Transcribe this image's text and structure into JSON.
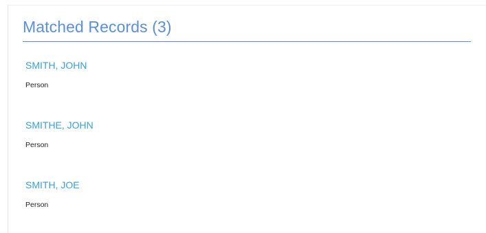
{
  "matched_records": {
    "title": "Matched Records (3)",
    "records": [
      {
        "name": "SMITH, JOHN",
        "type": "Person"
      },
      {
        "name": "SMITHE, JOHN",
        "type": "Person"
      },
      {
        "name": "SMITH, JOE",
        "type": "Person"
      }
    ]
  },
  "colors": {
    "title": "#5b8fd9",
    "record_link": "#3a9fd6",
    "record_type": "#222222"
  }
}
